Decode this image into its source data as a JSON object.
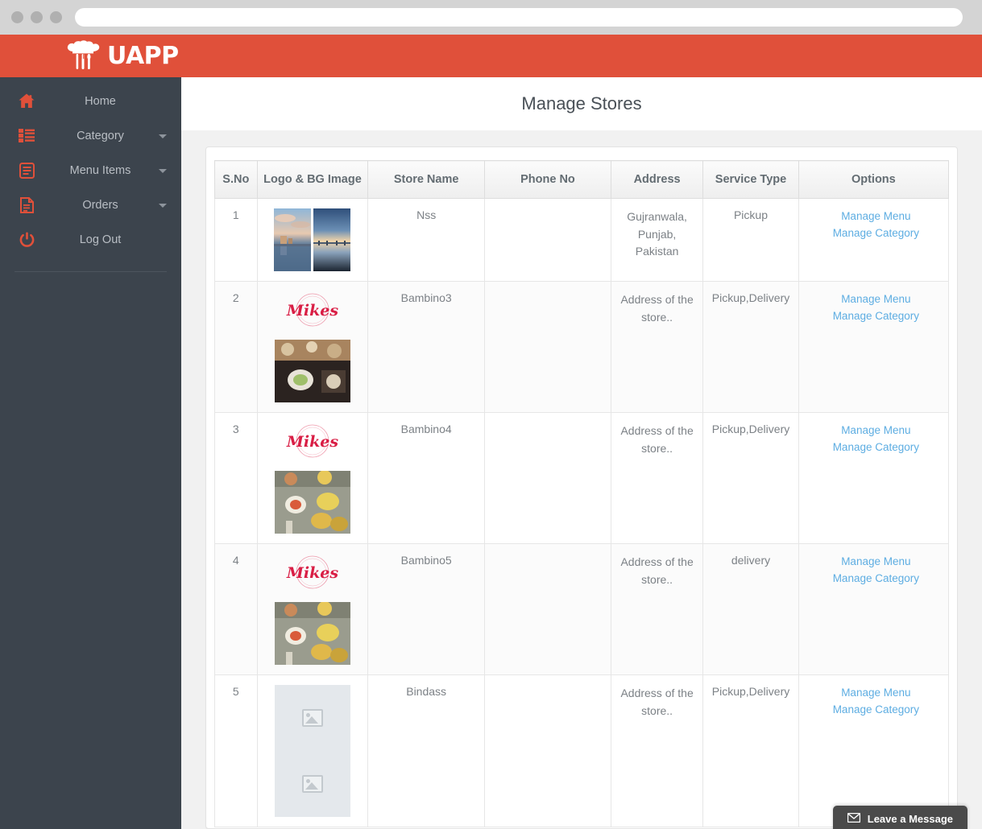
{
  "browser": {
    "url_value": "",
    "url_placeholder": "",
    "dots": [
      "close-dot",
      "minimize-dot",
      "maximize-dot"
    ]
  },
  "header": {
    "brand_name": "UAPP",
    "brand_icon": "chef-hat-utensils-icon",
    "background_color": "#e0503a"
  },
  "sidebar": {
    "background_color": "#3c444d",
    "items": [
      {
        "label": "Home",
        "icon": "home-icon",
        "has_caret": false
      },
      {
        "label": "Category",
        "icon": "list-icon",
        "has_caret": true
      },
      {
        "label": "Menu Items",
        "icon": "menu-book-icon",
        "has_caret": true
      },
      {
        "label": "Orders",
        "icon": "document-icon",
        "has_caret": true
      },
      {
        "label": "Log Out",
        "icon": "power-icon",
        "has_caret": false
      }
    ]
  },
  "main": {
    "page_title": "Manage Stores",
    "table": {
      "columns": [
        "S.No",
        "Logo & BG Image",
        "Store Name",
        "Phone No",
        "Address",
        "Service Type",
        "Options"
      ],
      "option_links": [
        "Manage Menu",
        "Manage Category"
      ],
      "link_color": "#5dade2",
      "rows": [
        {
          "sno": "1",
          "store_name": "Nss",
          "phone": "",
          "address": "Gujranwala, Punjab, Pakistan",
          "service_type": "Pickup",
          "image_kind": "two-photos",
          "options": [
            "Manage Menu",
            "Manage Category"
          ]
        },
        {
          "sno": "2",
          "store_name": "Bambino3",
          "phone": "",
          "address": "Address of the store..",
          "service_type": "Pickup,Delivery",
          "image_kind": "mikes-logo-and-photo",
          "options": [
            "Manage Menu",
            "Manage Category"
          ]
        },
        {
          "sno": "3",
          "store_name": "Bambino4",
          "phone": "",
          "address": "Address of the store..",
          "service_type": "Pickup,Delivery",
          "image_kind": "mikes-logo-and-photo",
          "options": [
            "Manage Menu",
            "Manage Category"
          ]
        },
        {
          "sno": "4",
          "store_name": "Bambino5",
          "phone": "",
          "address": "Address of the store..",
          "service_type": "delivery",
          "image_kind": "mikes-logo-and-photo",
          "options": [
            "Manage Menu",
            "Manage Category"
          ]
        },
        {
          "sno": "5",
          "store_name": "Bindass",
          "phone": "",
          "address": "Address of the store..",
          "service_type": "Pickup,Delivery",
          "image_kind": "broken-placeholders",
          "options": [
            "Manage Menu",
            "Manage Category"
          ]
        }
      ]
    }
  },
  "chat_widget": {
    "label": "Leave a Message",
    "icon": "envelope-icon"
  }
}
